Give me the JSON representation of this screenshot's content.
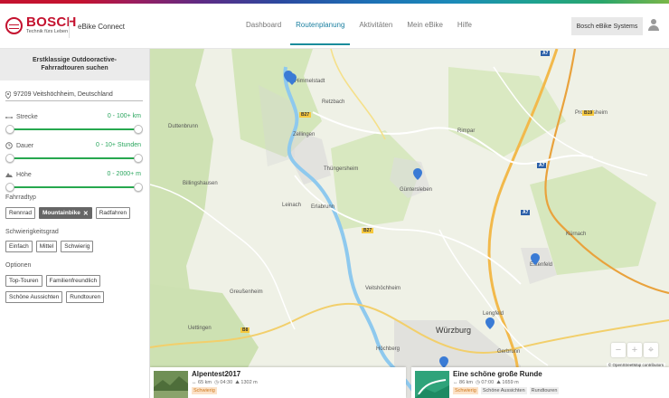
{
  "header": {
    "brand": "BOSCH",
    "tagline": "Technik fürs Leben",
    "app_title": "eBike Connect",
    "nav": [
      "Dashboard",
      "Routenplanung",
      "Aktivitäten",
      "Mein eBike",
      "Hilfe"
    ],
    "active_nav": "Routenplanung",
    "systems_button": "Bosch eBike Systems"
  },
  "sidebar": {
    "heading_line1": "Erstklassige Outdooractive-",
    "heading_line2": "Fahrradtouren suchen",
    "location": "97209 Veitshöchheim, Deutschland",
    "filters": [
      {
        "label": "Strecke",
        "value": "0 - 100+ km",
        "icon": "ruler-icon"
      },
      {
        "label": "Dauer",
        "value": "0 - 10+ Stunden",
        "icon": "clock-icon"
      },
      {
        "label": "Höhe",
        "value": "0 - 2000+ m",
        "icon": "elevation-icon"
      }
    ],
    "bike_type": {
      "title": "Fahrradtyp",
      "options": [
        "Rennrad",
        "Mountainbike",
        "Radfahren"
      ],
      "selected": "Mountainbike"
    },
    "difficulty": {
      "title": "Schwierigkeitsgrad",
      "options": [
        "Einfach",
        "Mittel",
        "Schwierig"
      ]
    },
    "options": {
      "title": "Optionen",
      "options": [
        "Top-Touren",
        "Familienfreundlich",
        "Schöne Aussichten",
        "Rundtouren"
      ]
    }
  },
  "map": {
    "towns": [
      "Himmelstadt",
      "Zellingen",
      "Thüngersheim",
      "Güntersleben",
      "Estenfeld",
      "Würzburg",
      "Gerbrunn",
      "Erlabrunn",
      "Veitshöchheim",
      "Höchberg",
      "Leinach",
      "Retzbach",
      "Kürnach",
      "Lengfeld",
      "Billingshausen",
      "Duttenbrunn",
      "Greußenheim",
      "Uettingen",
      "Rimpar",
      "Prosselsheim"
    ],
    "roads": [
      "B27",
      "B27",
      "B8",
      "B8",
      "B19",
      "A7",
      "A7",
      "A7"
    ],
    "attribution": "© OpenStreetMap contributors",
    "zoom_in": "+",
    "zoom_out": "−"
  },
  "cards": [
    {
      "title": "Alpentest2017",
      "distance": "65 km",
      "duration": "04:30",
      "elevation": "1302 m",
      "tags": [
        "Schwierig"
      ]
    },
    {
      "title": "Eine schöne große Runde",
      "distance": "86 km",
      "duration": "07:00",
      "elevation": "1659 m",
      "tags": [
        "Schwierig",
        "Schöne Aussichten",
        "Rundtouren"
      ]
    }
  ],
  "colors": {
    "brand_red": "#c4122f",
    "accent_teal": "#1a8c9c",
    "slider_green": "#27a84f",
    "marker_blue": "#3a7bd5"
  }
}
